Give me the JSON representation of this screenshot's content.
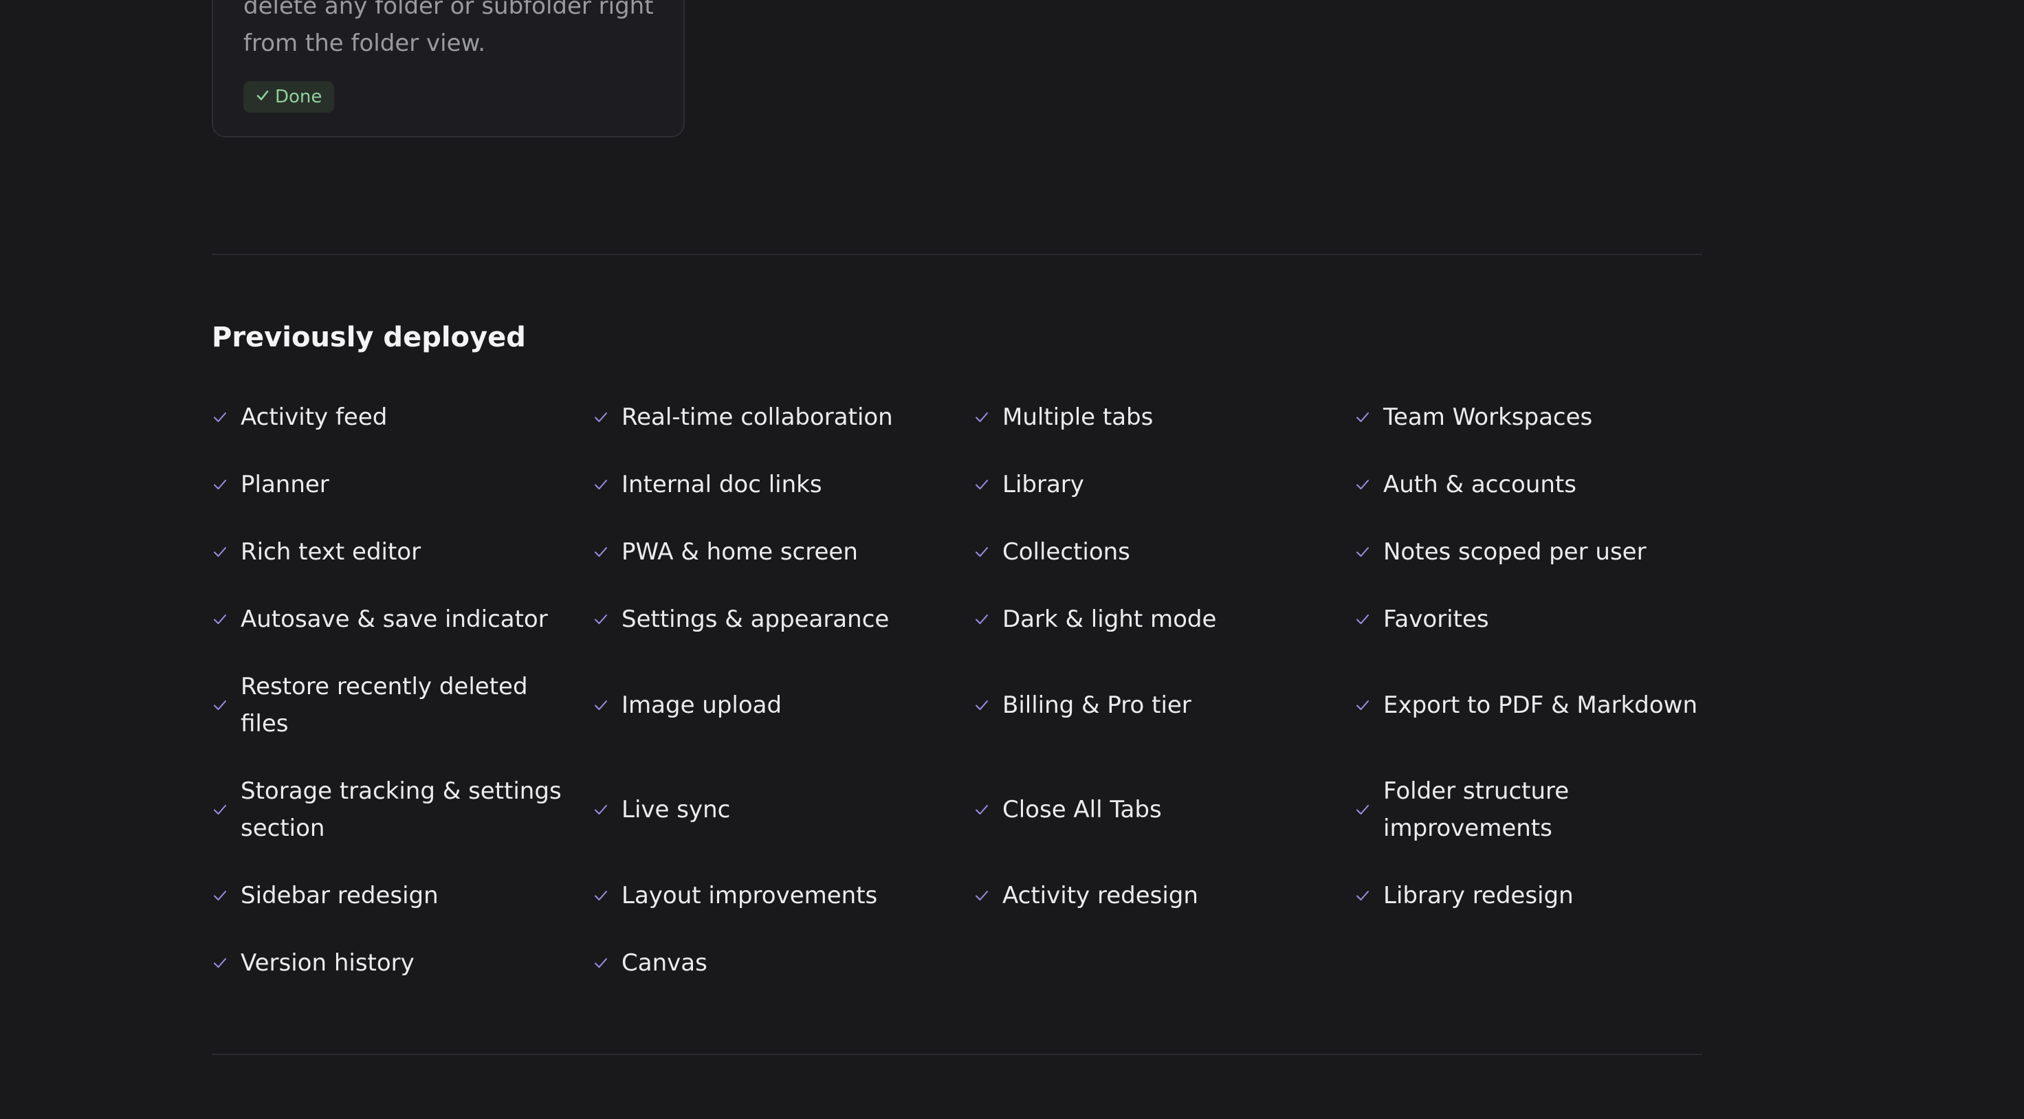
{
  "card": {
    "description": "delete any folder or subfolder right from the folder view.",
    "badge_icon": "check-icon",
    "badge_label": "Done",
    "badge_color": "#8fd19e"
  },
  "section": {
    "title": "Previously deployed",
    "check_color": "#9a8fe0",
    "items": [
      "Activity feed",
      "Real-time collaboration",
      "Multiple tabs",
      "Team Workspaces",
      "Planner",
      "Internal doc links",
      "Library",
      "Auth & accounts",
      "Rich text editor",
      "PWA & home screen",
      "Collections",
      "Notes scoped per user",
      "Autosave & save indicator",
      "Settings & appearance",
      "Dark & light mode",
      "Favorites",
      "Restore recently deleted files",
      "Image upload",
      "Billing & Pro tier",
      "Export to PDF & Markdown",
      "Storage tracking & settings section",
      "Live sync",
      "Close All Tabs",
      "Folder structure improvements",
      "Sidebar redesign",
      "Layout improvements",
      "Activity redesign",
      "Library redesign",
      "Version history",
      "Canvas"
    ]
  }
}
